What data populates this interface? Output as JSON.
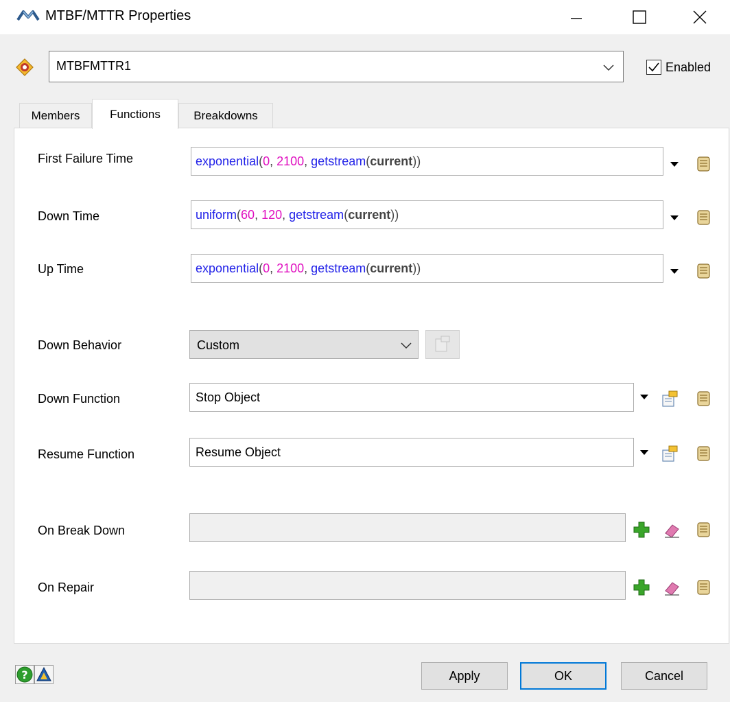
{
  "window": {
    "title": "MTBF/MTTR Properties",
    "icon": "mtbf-mttr-icon",
    "controls": [
      "minimize-icon",
      "maximize-icon",
      "close-icon"
    ]
  },
  "header": {
    "object_name": "MTBFMTTR1",
    "enabled_label": "Enabled",
    "enabled_checked": true
  },
  "tabs": [
    {
      "label": "Members",
      "active": false
    },
    {
      "label": "Functions",
      "active": true
    },
    {
      "label": "Breakdowns",
      "active": false
    }
  ],
  "fields": {
    "first_failure_time": {
      "label": "First Failure Time",
      "tokens": [
        {
          "t": "exponential",
          "c": "fn"
        },
        {
          "t": "(",
          "c": "p"
        },
        {
          "t": "0",
          "c": "num"
        },
        {
          "t": ", ",
          "c": "p"
        },
        {
          "t": "2100",
          "c": "num"
        },
        {
          "t": ", ",
          "c": "p"
        },
        {
          "t": "getstream",
          "c": "fn"
        },
        {
          "t": "(",
          "c": "p"
        },
        {
          "t": "current",
          "c": "kw"
        },
        {
          "t": "))",
          "c": "p"
        }
      ]
    },
    "down_time": {
      "label": "Down Time",
      "tokens": [
        {
          "t": "uniform",
          "c": "fn"
        },
        {
          "t": "(",
          "c": "p"
        },
        {
          "t": "60",
          "c": "num"
        },
        {
          "t": ", ",
          "c": "p"
        },
        {
          "t": "120",
          "c": "num"
        },
        {
          "t": ", ",
          "c": "p"
        },
        {
          "t": "getstream",
          "c": "fn"
        },
        {
          "t": "(",
          "c": "p"
        },
        {
          "t": "current",
          "c": "kw"
        },
        {
          "t": "))",
          "c": "p"
        }
      ]
    },
    "up_time": {
      "label": "Up Time",
      "tokens": [
        {
          "t": "exponential",
          "c": "fn"
        },
        {
          "t": "(",
          "c": "p"
        },
        {
          "t": "0",
          "c": "num"
        },
        {
          "t": ", ",
          "c": "p"
        },
        {
          "t": "2100",
          "c": "num"
        },
        {
          "t": ", ",
          "c": "p"
        },
        {
          "t": "getstream",
          "c": "fn"
        },
        {
          "t": "(",
          "c": "p"
        },
        {
          "t": "current",
          "c": "kw"
        },
        {
          "t": "))",
          "c": "p"
        }
      ]
    },
    "down_behavior": {
      "label": "Down Behavior",
      "value": "Custom"
    },
    "down_function": {
      "label": "Down Function",
      "value": "Stop Object"
    },
    "resume_function": {
      "label": "Resume Function",
      "value": "Resume Object"
    },
    "on_break_down": {
      "label": "On Break Down",
      "value": ""
    },
    "on_repair": {
      "label": "On Repair",
      "value": ""
    }
  },
  "footer": {
    "apply_label": "Apply",
    "ok_label": "OK",
    "cancel_label": "Cancel"
  },
  "colors": {
    "code_function": "#2222e8",
    "code_number": "#e010c0",
    "code_keyword": "#444444",
    "ok_border": "#0078d7",
    "add_green": "#3aa52a",
    "eraser_pink": "#e07ab0",
    "script_tan": "#c8a75a"
  }
}
